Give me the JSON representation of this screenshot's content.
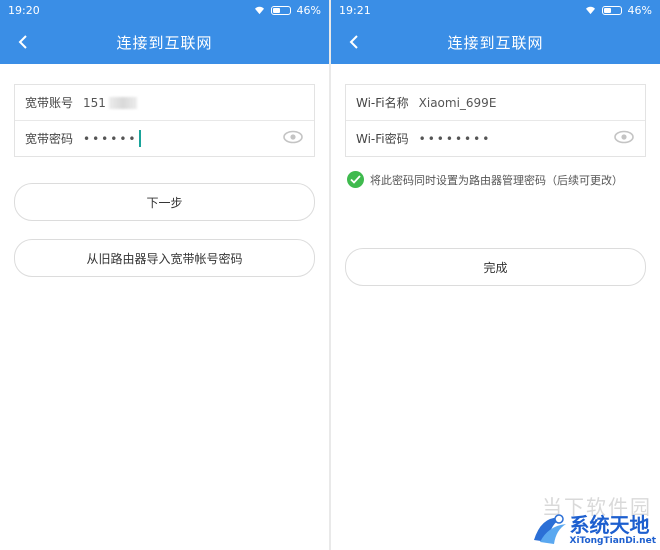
{
  "left": {
    "status": {
      "time": "19:20",
      "battery": "46%"
    },
    "title": "连接到互联网",
    "fields": [
      {
        "label": "宽带账号",
        "value": "151"
      },
      {
        "label": "宽带密码",
        "value": "••••••"
      }
    ],
    "buttons": {
      "next": "下一步",
      "import": "从旧路由器导入宽带帐号密码"
    }
  },
  "right": {
    "status": {
      "time": "19:21",
      "battery": "46%"
    },
    "title": "连接到互联网",
    "fields": [
      {
        "label": "Wi-Fi名称",
        "value": "Xiaomi_699E"
      },
      {
        "label": "Wi-Fi密码",
        "value": "••••••••"
      }
    ],
    "checkbox_label": "将此密码同时设置为路由器管理密码（后续可更改）",
    "buttons": {
      "done": "完成"
    }
  },
  "watermark": {
    "ghost_text": "当下软件园",
    "title": "系统天地",
    "url": "XiTongTianDi.net"
  },
  "colors": {
    "accent": "#3a8ee6",
    "check": "#3fba4e",
    "cursor": "#1aa39a"
  },
  "battery_level": 0.46
}
